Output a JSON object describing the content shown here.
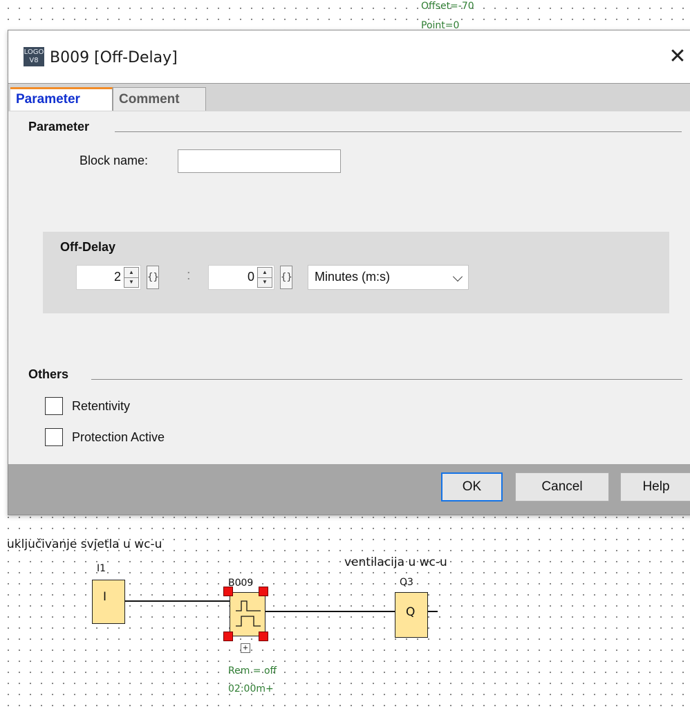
{
  "canvas": {
    "top_note_1": "Offset=-70",
    "top_note_2": "Point=0",
    "label_left": "uključivanje svjetla u wc-u",
    "label_right": "ventilacija u wc-u",
    "input_block": {
      "name": "I1",
      "symbol": "I"
    },
    "function_block": {
      "name": "B009",
      "rem": "Rem = off",
      "time": "02:00m+",
      "expand": "+"
    },
    "output_block": {
      "name": "Q3",
      "symbol": "Q"
    }
  },
  "dialog": {
    "icon_line1": "LOGO",
    "icon_line2": "V8",
    "title": "B009 [Off-Delay]",
    "close": "✕",
    "tabs": [
      "Parameter",
      "Comment"
    ],
    "parameter_section": "Parameter",
    "block_name_label": "Block name:",
    "block_name_value": "",
    "off_delay": {
      "label": "Off-Delay",
      "first_value": "2",
      "second_value": "0",
      "separator": ":",
      "brace": "{}",
      "unit": "Minutes (m:s)"
    },
    "others_section": "Others",
    "checkboxes": [
      {
        "label": "Retentivity",
        "checked": false
      },
      {
        "label": "Protection Active",
        "checked": false
      }
    ],
    "buttons": {
      "ok": "OK",
      "cancel": "Cancel",
      "help": "Help"
    }
  }
}
